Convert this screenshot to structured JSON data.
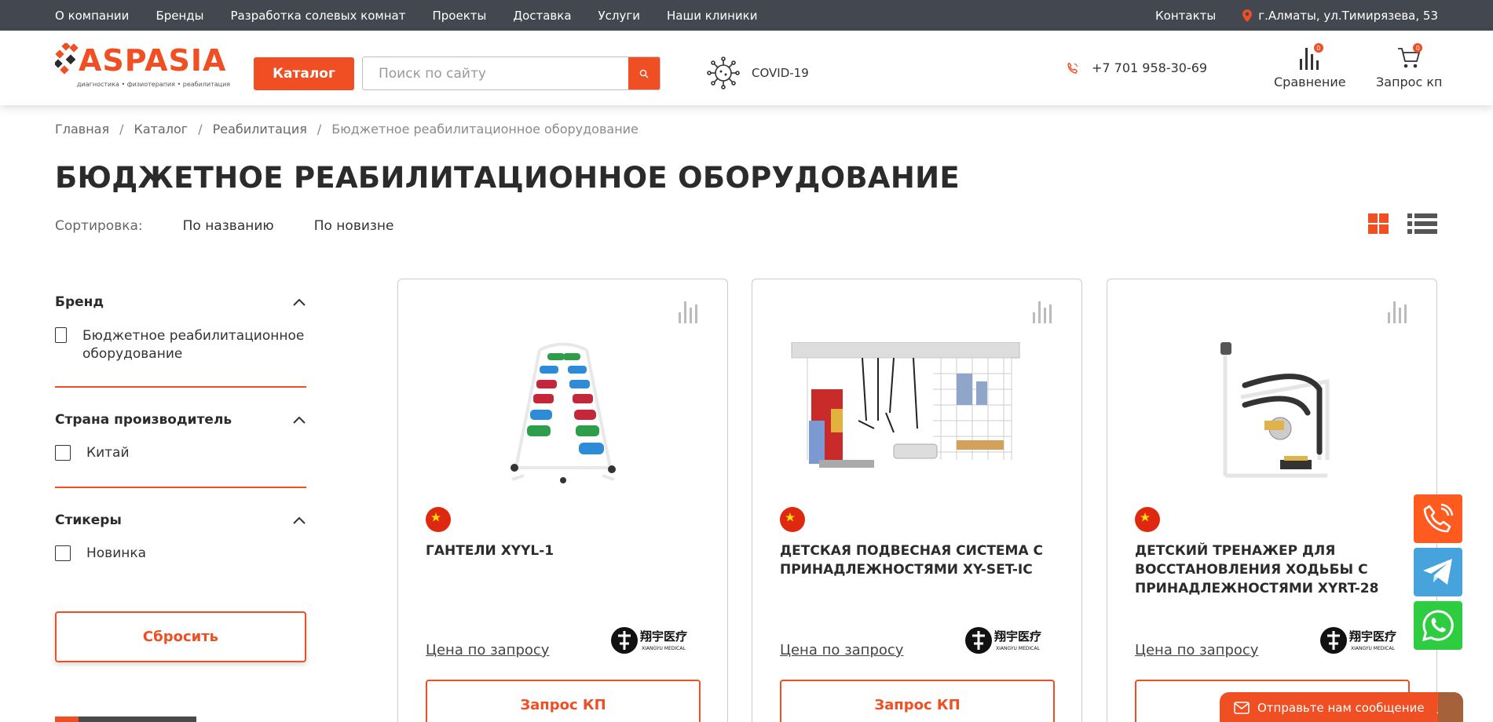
{
  "topbar": {
    "nav": [
      "О компании",
      "Бренды",
      "Разработка солевых комнат",
      "Проекты",
      "Доставка",
      "Услуги",
      "Наши клиники"
    ],
    "contacts": "Контакты",
    "address": "г.Алматы, ул.Тимирязева, 53"
  },
  "header": {
    "logo_text": "ASPASIA",
    "logo_tagline": "диагностика • физиотерапия • реабилитация",
    "catalog_label": "Каталог",
    "search_placeholder": "Поиск по сайту",
    "covid_label": "COVID-19",
    "phone": "+7 701 958-30-69",
    "compare_label": "Сравнение",
    "compare_count": "0",
    "request_label": "Запрос кп",
    "request_count": "0"
  },
  "breadcrumb": [
    "Главная",
    "Каталог",
    "Реабилитация",
    "Бюджетное реабилитационное оборудование"
  ],
  "page_title": "БЮДЖЕТНОЕ РЕАБИЛИТАЦИОННОЕ ОБОРУДОВАНИЕ",
  "sort": {
    "label": "Сортировка:",
    "options": [
      "По названию",
      "По новизне"
    ]
  },
  "filters": [
    {
      "title": "Бренд",
      "options": [
        "Бюджетное реабилитационное оборудование"
      ]
    },
    {
      "title": "Страна производитель",
      "options": [
        "Китай"
      ]
    },
    {
      "title": "Стикеры",
      "options": [
        "Новинка"
      ]
    }
  ],
  "reset_label": "Сбросить",
  "products": [
    {
      "name": "ГАНТЕЛИ XYYL-1",
      "price": "Цена по запросу",
      "button": "Запрос КП",
      "brand_cn": "翔宇医疗",
      "brand_en": "XIANGYU MEDICAL"
    },
    {
      "name": "ДЕТСКАЯ ПОДВЕСНАЯ СИСТЕМА С ПРИНАДЛЕЖНОСТЯМИ XY-SET-IC",
      "price": "Цена по запросу",
      "button": "Запрос КП",
      "brand_cn": "翔宇医疗",
      "brand_en": "XIANGYU MEDICAL"
    },
    {
      "name": "ДЕТСКИЙ ТРЕНАЖЕР ДЛЯ ВОССТАНОВЛЕНИЯ ХОДЬБЫ С ПРИНАДЛЕЖНОСТЯМИ XYRT-28",
      "price": "Цена по запросу",
      "button": "Запрос КП",
      "brand_cn": "翔宇医疗",
      "brand_en": "XIANGYU MEDICAL"
    }
  ],
  "chat": {
    "message": "Отправьте нам сообщение",
    "brand": "jivo"
  },
  "colors": {
    "accent": "#f04e23",
    "topbar": "#434850",
    "phone_btn": "#ff5a1f",
    "telegram": "#47a3dc",
    "whatsapp": "#2ecc40"
  }
}
